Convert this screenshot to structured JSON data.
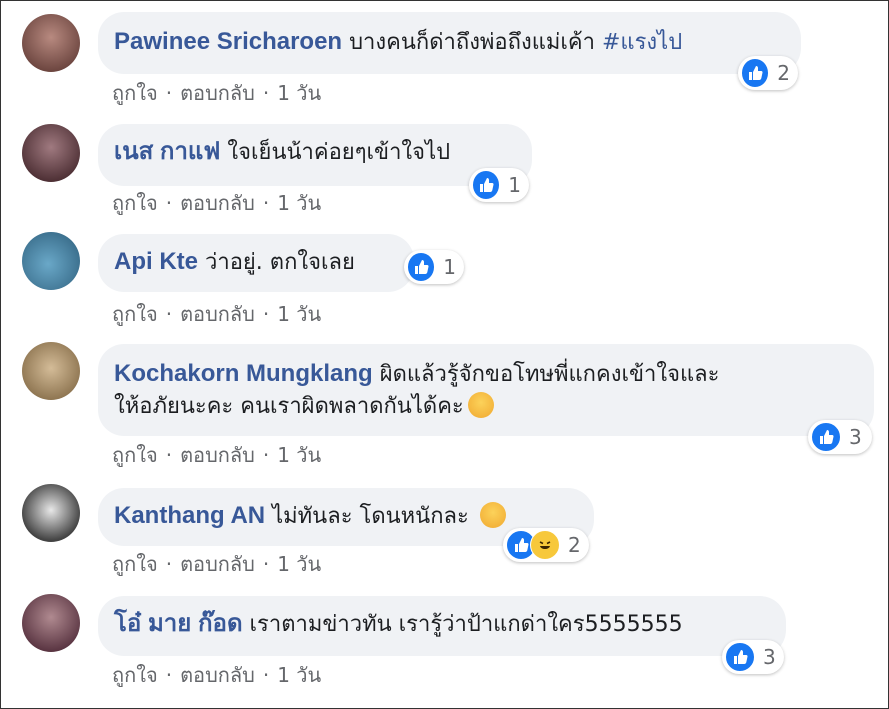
{
  "actions": {
    "like": "ถูกใจ",
    "reply": "ตอบกลับ",
    "time": "1 วัน",
    "dot": "·"
  },
  "colors": {
    "author": "#385898",
    "bubble": "#f0f2f5",
    "like": "#1877f2",
    "meta": "#65676b"
  },
  "comments": [
    {
      "author": "Pawinee Sricharoen",
      "text": "บางคนก็ด่าถึงพ่อถึงแม่เค้า ",
      "tag": "#แรงไป",
      "reactions": [
        "like-icon"
      ],
      "count": "2",
      "avatar_color": "#8a5a52"
    },
    {
      "author": "เนส กาแฟ",
      "text": "ใจเย็นน้าค่อยๆเข้าใจไป",
      "reactions": [
        "like-icon"
      ],
      "count": "1",
      "avatar_color": "#6e4f55"
    },
    {
      "author": "Api Kte",
      "text": "ว่าอยู่. ตกใจเลย",
      "reactions": [
        "like-icon"
      ],
      "count": "1",
      "avatar_color": "#4f8fb0"
    },
    {
      "author": "Kochakorn Mungklang",
      "text_line1": "ผิดแล้วรู้จักขอโทษพี่แกคงเข้าใจและ",
      "text_line2": "ให้อภัยนะคะ คนเราผิดพลาดกันได้คะ",
      "emoji": "smiling-face-icon",
      "reactions": [
        "like-icon"
      ],
      "count": "3",
      "avatar_color": "#b49a76"
    },
    {
      "author": "Kanthang AN",
      "text": "ไม่ทันละ โดนหนักละ ",
      "emoji": "grinning-face-icon",
      "reactions": [
        "like-icon",
        "haha-icon"
      ],
      "count": "2",
      "avatar_color": "#6a6a6a"
    },
    {
      "author": "โอ๋ มาย ก๊อด",
      "text": "เราตามข่าวทัน เรารู้ว่าป้าแกด่าใคร5555555",
      "reactions": [
        "like-icon"
      ],
      "count": "3",
      "avatar_color": "#7a5060"
    }
  ]
}
